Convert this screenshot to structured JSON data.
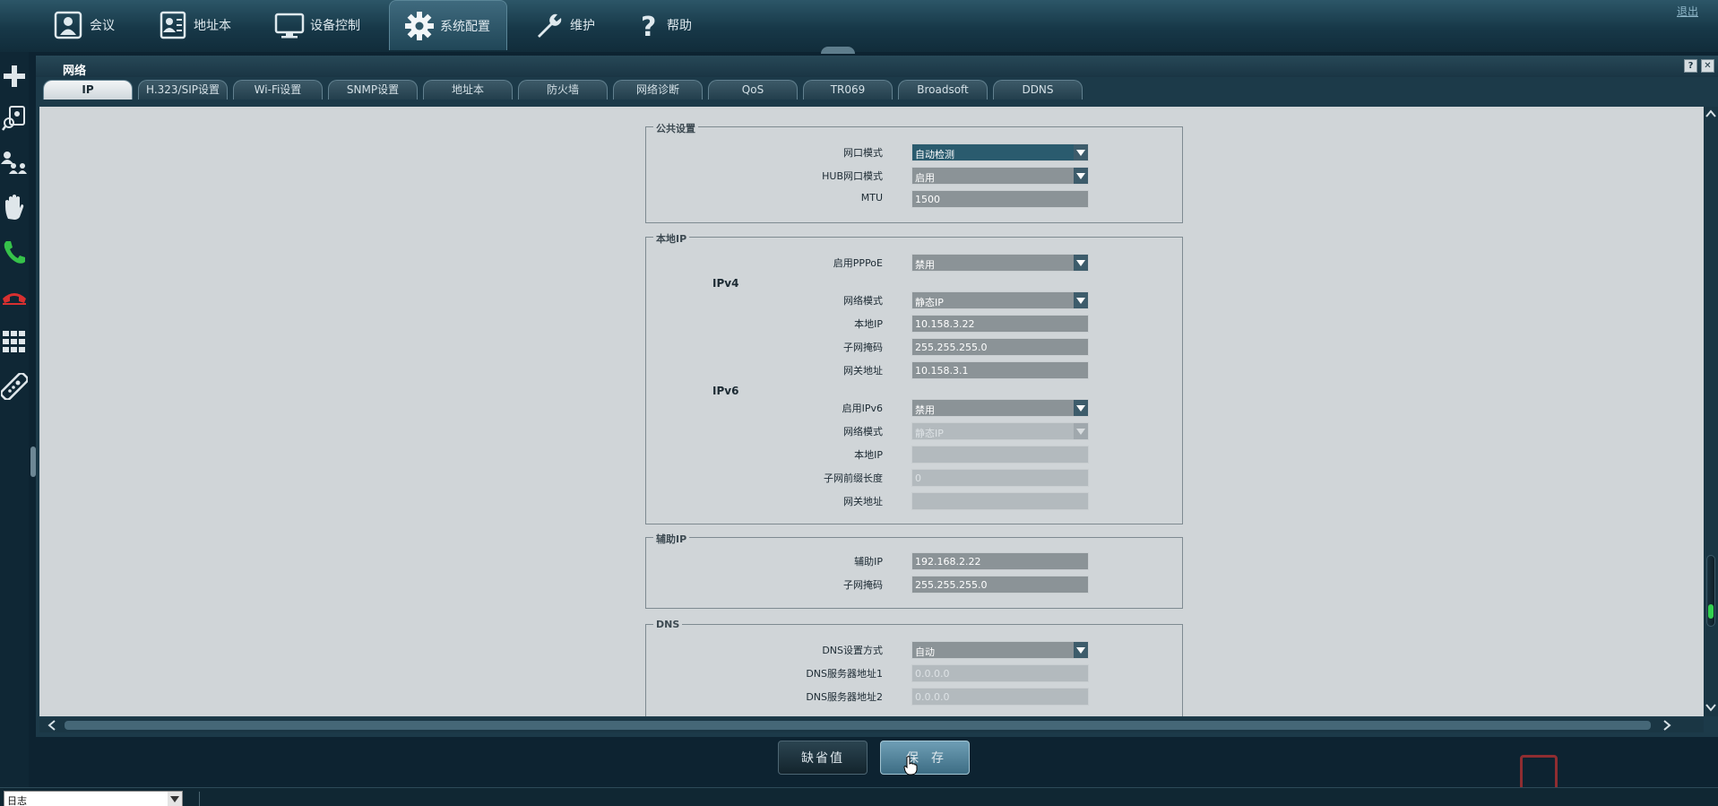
{
  "nav": {
    "items": [
      {
        "label": "会议",
        "icon": "meeting-icon"
      },
      {
        "label": "地址本",
        "icon": "contacts-icon"
      },
      {
        "label": "设备控制",
        "icon": "monitor-icon"
      },
      {
        "label": "系统配置",
        "icon": "gear-icon",
        "active": true
      },
      {
        "label": "维护",
        "icon": "wrench-icon"
      },
      {
        "label": "帮助",
        "icon": "question-icon"
      }
    ],
    "logout": "退出"
  },
  "panel": {
    "title": "网络",
    "help": "?",
    "close": "✕"
  },
  "tabs": [
    "IP",
    "H.323/SIP设置",
    "Wi-Fi设置",
    "SNMP设置",
    "地址本",
    "防火墙",
    "网络诊断",
    "QoS",
    "TR069",
    "Broadsoft",
    "DDNS"
  ],
  "common": {
    "legend": "公共设置",
    "port_mode": {
      "label": "网口模式",
      "value": "自动检测"
    },
    "hub_mode": {
      "label": "HUB网口模式",
      "value": "启用"
    },
    "mtu": {
      "label": "MTU",
      "value": "1500"
    }
  },
  "local_ip": {
    "legend": "本地IP",
    "pppoe": {
      "label": "启用PPPoE",
      "value": "禁用"
    },
    "ipv4_title": "IPv4",
    "v4_mode": {
      "label": "网络模式",
      "value": "静态IP"
    },
    "v4_ip": {
      "label": "本地IP",
      "value": "10.158.3.22"
    },
    "v4_mask": {
      "label": "子网掩码",
      "value": "255.255.255.0"
    },
    "v4_gw": {
      "label": "网关地址",
      "value": "10.158.3.1"
    },
    "ipv6_title": "IPv6",
    "v6_enable": {
      "label": "启用IPv6",
      "value": "禁用"
    },
    "v6_mode": {
      "label": "网络模式",
      "value": "静态IP"
    },
    "v6_ip": {
      "label": "本地IP",
      "value": ""
    },
    "v6_prefix": {
      "label": "子网前缀长度",
      "value": "0"
    },
    "v6_gw": {
      "label": "网关地址",
      "value": ""
    }
  },
  "aux_ip": {
    "legend": "辅助IP",
    "ip": {
      "label": "辅助IP",
      "value": "192.168.2.22"
    },
    "mask": {
      "label": "子网掩码",
      "value": "255.255.255.0"
    }
  },
  "dns": {
    "legend": "DNS",
    "mode": {
      "label": "DNS设置方式",
      "value": "自动"
    },
    "server1": {
      "label": "DNS服务器地址1",
      "value": "0.0.0.0"
    },
    "server2": {
      "label": "DNS服务器地址2",
      "value": "0.0.0.0"
    }
  },
  "footer": {
    "default_btn": "缺省值",
    "save_btn": "保存"
  },
  "statusbar": {
    "log_select": "日志"
  },
  "colors": {
    "accent": "#2a5b6e",
    "content_bg": "#d0d5d8",
    "frame": "#1c3a49"
  }
}
